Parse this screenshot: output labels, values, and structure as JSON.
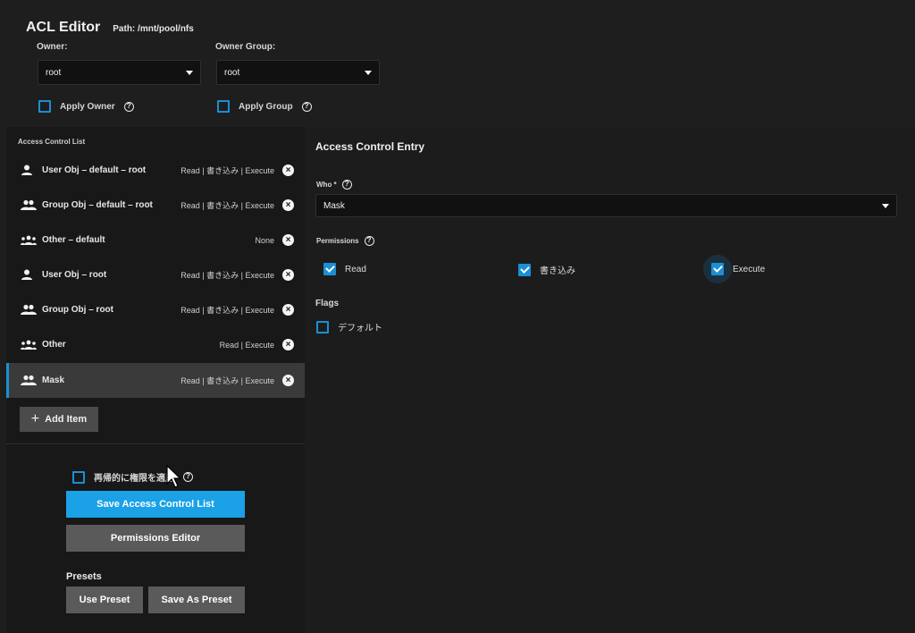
{
  "header": {
    "title": "ACL Editor",
    "path": "Path:  /mnt/pool/nfs",
    "owner_label": "Owner:",
    "owner_value": "root",
    "group_label": "Owner Group:",
    "group_value": "root",
    "apply_owner": "Apply Owner",
    "apply_group": "Apply Group"
  },
  "acl": {
    "title": "Access Control List",
    "items": [
      {
        "name": "User Obj – default – root",
        "perms": "Read | 書き込み | Execute",
        "icon": "person-icon"
      },
      {
        "name": "Group Obj – default – root",
        "perms": "Read | 書き込み | Execute",
        "icon": "group-icon"
      },
      {
        "name": "Other – default",
        "perms": "None",
        "icon": "groups-icon"
      },
      {
        "name": "User Obj – root",
        "perms": "Read | 書き込み | Execute",
        "icon": "person-icon"
      },
      {
        "name": "Group Obj – root",
        "perms": "Read | 書き込み | Execute",
        "icon": "group-icon"
      },
      {
        "name": "Other",
        "perms": "Read | Execute",
        "icon": "groups-icon"
      },
      {
        "name": "Mask",
        "perms": "Read | 書き込み | Execute",
        "icon": "group-icon",
        "selected": true
      }
    ],
    "add_item": "Add Item",
    "recursive": "再帰的に権限を適用",
    "save_button": "Save Access Control List",
    "permissions_editor": "Permissions Editor",
    "presets_label": "Presets",
    "use_preset": "Use Preset",
    "save_as_preset": "Save As Preset"
  },
  "entry": {
    "title": "Access Control Entry",
    "who_label": "Who *",
    "who_value": "Mask",
    "permissions_label": "Permissions",
    "permissions": [
      {
        "label": "Read",
        "checked": true
      },
      {
        "label": "書き込み",
        "checked": true
      },
      {
        "label": "Execute",
        "checked": true
      }
    ],
    "flags_label": "Flags",
    "flag_default": "デフォルト",
    "flag_default_checked": false
  },
  "colors": {
    "accent": "#1a8fd6",
    "primary_button": "#1aa1e6",
    "secondary_button": "#5a5a5a"
  }
}
